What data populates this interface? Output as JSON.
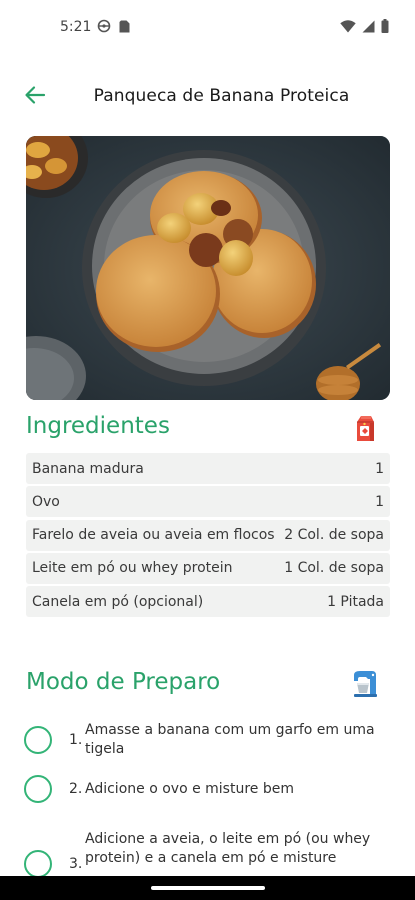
{
  "status_bar": {
    "time": "5:21",
    "icons_left": [
      "vpn-icon",
      "sim-card-icon"
    ],
    "icons_right": [
      "wifi-icon",
      "cell-signal-icon",
      "battery-icon"
    ]
  },
  "header": {
    "title": "Panqueca de Banana Proteica",
    "back_icon": "arrow-left-icon"
  },
  "colors": {
    "accent": "#2aa26a",
    "checkbox": "#33b477",
    "row_bg": "#f1f2f1"
  },
  "ingredients": {
    "title": "Ingredientes",
    "icon": "milk-carton-icon",
    "items": [
      {
        "name": "Banana madura",
        "qty": "1"
      },
      {
        "name": "Ovo",
        "qty": "1"
      },
      {
        "name": "Farelo de aveia ou aveia em flocos",
        "qty": "2 Col. de sopa"
      },
      {
        "name": "Leite em pó ou whey protein",
        "qty": "1 Col. de sopa"
      },
      {
        "name": "Canela em pó (opcional)",
        "qty": "1 Pitada"
      }
    ]
  },
  "preparation": {
    "title": "Modo de Preparo",
    "icon": "stand-mixer-icon",
    "steps": [
      {
        "num": "1.",
        "text": "Amasse a banana com um garfo em uma tigela"
      },
      {
        "num": "2.",
        "text": "Adicione o ovo e misture bem"
      },
      {
        "num": "3.",
        "text": "Adicione a aveia, o leite em pó (ou whey protein) e a canela em pó e misture"
      }
    ]
  }
}
